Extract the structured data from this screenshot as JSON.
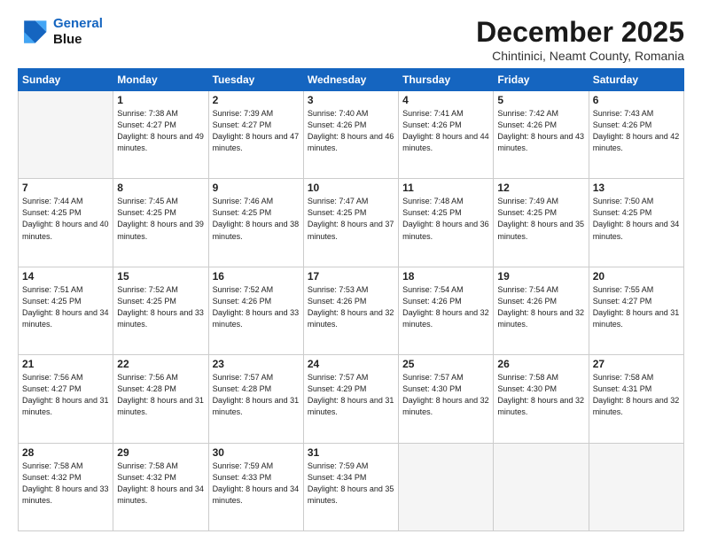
{
  "header": {
    "logo_line1": "General",
    "logo_line2": "Blue",
    "main_title": "December 2025",
    "subtitle": "Chintinici, Neamt County, Romania"
  },
  "calendar": {
    "days_of_week": [
      "Sunday",
      "Monday",
      "Tuesday",
      "Wednesday",
      "Thursday",
      "Friday",
      "Saturday"
    ],
    "weeks": [
      [
        {
          "day": "",
          "info": ""
        },
        {
          "day": "1",
          "info": "Sunrise: 7:38 AM\nSunset: 4:27 PM\nDaylight: 8 hours\nand 49 minutes."
        },
        {
          "day": "2",
          "info": "Sunrise: 7:39 AM\nSunset: 4:27 PM\nDaylight: 8 hours\nand 47 minutes."
        },
        {
          "day": "3",
          "info": "Sunrise: 7:40 AM\nSunset: 4:26 PM\nDaylight: 8 hours\nand 46 minutes."
        },
        {
          "day": "4",
          "info": "Sunrise: 7:41 AM\nSunset: 4:26 PM\nDaylight: 8 hours\nand 44 minutes."
        },
        {
          "day": "5",
          "info": "Sunrise: 7:42 AM\nSunset: 4:26 PM\nDaylight: 8 hours\nand 43 minutes."
        },
        {
          "day": "6",
          "info": "Sunrise: 7:43 AM\nSunset: 4:26 PM\nDaylight: 8 hours\nand 42 minutes."
        }
      ],
      [
        {
          "day": "7",
          "info": "Sunrise: 7:44 AM\nSunset: 4:25 PM\nDaylight: 8 hours\nand 40 minutes."
        },
        {
          "day": "8",
          "info": "Sunrise: 7:45 AM\nSunset: 4:25 PM\nDaylight: 8 hours\nand 39 minutes."
        },
        {
          "day": "9",
          "info": "Sunrise: 7:46 AM\nSunset: 4:25 PM\nDaylight: 8 hours\nand 38 minutes."
        },
        {
          "day": "10",
          "info": "Sunrise: 7:47 AM\nSunset: 4:25 PM\nDaylight: 8 hours\nand 37 minutes."
        },
        {
          "day": "11",
          "info": "Sunrise: 7:48 AM\nSunset: 4:25 PM\nDaylight: 8 hours\nand 36 minutes."
        },
        {
          "day": "12",
          "info": "Sunrise: 7:49 AM\nSunset: 4:25 PM\nDaylight: 8 hours\nand 35 minutes."
        },
        {
          "day": "13",
          "info": "Sunrise: 7:50 AM\nSunset: 4:25 PM\nDaylight: 8 hours\nand 34 minutes."
        }
      ],
      [
        {
          "day": "14",
          "info": "Sunrise: 7:51 AM\nSunset: 4:25 PM\nDaylight: 8 hours\nand 34 minutes."
        },
        {
          "day": "15",
          "info": "Sunrise: 7:52 AM\nSunset: 4:25 PM\nDaylight: 8 hours\nand 33 minutes."
        },
        {
          "day": "16",
          "info": "Sunrise: 7:52 AM\nSunset: 4:26 PM\nDaylight: 8 hours\nand 33 minutes."
        },
        {
          "day": "17",
          "info": "Sunrise: 7:53 AM\nSunset: 4:26 PM\nDaylight: 8 hours\nand 32 minutes."
        },
        {
          "day": "18",
          "info": "Sunrise: 7:54 AM\nSunset: 4:26 PM\nDaylight: 8 hours\nand 32 minutes."
        },
        {
          "day": "19",
          "info": "Sunrise: 7:54 AM\nSunset: 4:26 PM\nDaylight: 8 hours\nand 32 minutes."
        },
        {
          "day": "20",
          "info": "Sunrise: 7:55 AM\nSunset: 4:27 PM\nDaylight: 8 hours\nand 31 minutes."
        }
      ],
      [
        {
          "day": "21",
          "info": "Sunrise: 7:56 AM\nSunset: 4:27 PM\nDaylight: 8 hours\nand 31 minutes."
        },
        {
          "day": "22",
          "info": "Sunrise: 7:56 AM\nSunset: 4:28 PM\nDaylight: 8 hours\nand 31 minutes."
        },
        {
          "day": "23",
          "info": "Sunrise: 7:57 AM\nSunset: 4:28 PM\nDaylight: 8 hours\nand 31 minutes."
        },
        {
          "day": "24",
          "info": "Sunrise: 7:57 AM\nSunset: 4:29 PM\nDaylight: 8 hours\nand 31 minutes."
        },
        {
          "day": "25",
          "info": "Sunrise: 7:57 AM\nSunset: 4:30 PM\nDaylight: 8 hours\nand 32 minutes."
        },
        {
          "day": "26",
          "info": "Sunrise: 7:58 AM\nSunset: 4:30 PM\nDaylight: 8 hours\nand 32 minutes."
        },
        {
          "day": "27",
          "info": "Sunrise: 7:58 AM\nSunset: 4:31 PM\nDaylight: 8 hours\nand 32 minutes."
        }
      ],
      [
        {
          "day": "28",
          "info": "Sunrise: 7:58 AM\nSunset: 4:32 PM\nDaylight: 8 hours\nand 33 minutes."
        },
        {
          "day": "29",
          "info": "Sunrise: 7:58 AM\nSunset: 4:32 PM\nDaylight: 8 hours\nand 34 minutes."
        },
        {
          "day": "30",
          "info": "Sunrise: 7:59 AM\nSunset: 4:33 PM\nDaylight: 8 hours\nand 34 minutes."
        },
        {
          "day": "31",
          "info": "Sunrise: 7:59 AM\nSunset: 4:34 PM\nDaylight: 8 hours\nand 35 minutes."
        },
        {
          "day": "",
          "info": ""
        },
        {
          "day": "",
          "info": ""
        },
        {
          "day": "",
          "info": ""
        }
      ]
    ]
  }
}
